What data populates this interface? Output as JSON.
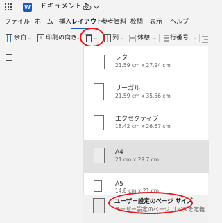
{
  "titlebar": {
    "app_icon": "word-logo",
    "app_letter": "W",
    "document_title": "ドキュメント 2",
    "status_icon": "cloud-sync-icon"
  },
  "menu": {
    "items": [
      "ファイル",
      "ホーム",
      "挿入",
      "レイアウト",
      "参考資料",
      "校閲",
      "表示",
      "ヘルプ"
    ],
    "active": "レイアウト"
  },
  "ribbon": {
    "margins_label": "余白",
    "orientation_label": "印刷の向き",
    "size_icon": "page-size-icon",
    "columns_label": "列",
    "breaks_label": "休憩",
    "line_numbers_label": "行番号"
  },
  "size_options": [
    {
      "name": "レター",
      "dims": "21.59 cm x 27.94 cm",
      "selected": false
    },
    {
      "name": "リーガル",
      "dims": "21.59 cm x 35.56 cm",
      "selected": false
    },
    {
      "name": "エクセクティブ",
      "dims": "18.42 cm x 26.67 cm",
      "selected": false
    },
    {
      "name": "A4",
      "dims": "21 cm x 29.7 cm",
      "selected": true
    },
    {
      "name": "A5",
      "dims": "14.8 cm x 21 cm",
      "selected": false
    }
  ],
  "custom_option": {
    "name": "ユーザー設定のページ サイズ",
    "description": "ユーザー設定のページ サイズを定義"
  },
  "colors": {
    "accent": "#185abd",
    "highlight_circle": "#e3191c",
    "selected_bg": "#e1e1e1"
  }
}
